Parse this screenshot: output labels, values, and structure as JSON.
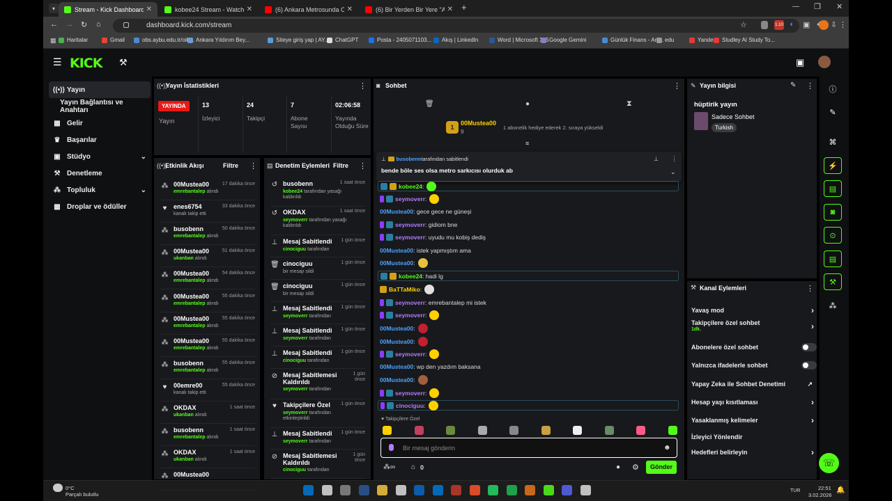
{
  "browser": {
    "tabs": [
      {
        "title": "Stream - Kick Dashboard",
        "color": "#53fc18"
      },
      {
        "title": "kobee24 Stream - Watch Live o",
        "color": "#53fc18"
      },
      {
        "title": "(6) Ankara Metrosunda OSB To",
        "color": "#ff0000"
      },
      {
        "title": "(6) Bir Yerden Bir Yere \"Ankara\"",
        "color": "#ff0000"
      }
    ],
    "url": "dashboard.kick.com/stream",
    "ext_badge": "1.10",
    "bookmarks": [
      "Haritalar",
      "Gmail",
      "obs.aybu.edu.tr/oib...",
      "Ankara Yıldırım Bey...",
      "Siteye giriş yap | AY...",
      "ChatGPT",
      "Posta - 2405071103...",
      "Akış | LinkedIn",
      "Word | Microsoft 365",
      "Google Gemini",
      "Günlük Finans - Anl...",
      "edu",
      "Yandex",
      "Studley AI Study To..."
    ]
  },
  "brand": {
    "logo": "KICK",
    "accent": "#53fc18"
  },
  "nav": [
    {
      "label": "Yayın",
      "icon": "broadcast-icon"
    },
    {
      "label": "Yayın Bağlantısı ve Anahtarı",
      "icon": ""
    },
    {
      "label": "Gelir",
      "icon": "money-icon"
    },
    {
      "label": "Başarılar",
      "icon": "trophy-icon"
    },
    {
      "label": "Stüdyo",
      "icon": "studio-icon"
    },
    {
      "label": "Denetleme",
      "icon": "hammer-icon"
    },
    {
      "label": "Topluluk",
      "icon": "community-icon"
    },
    {
      "label": "Droplar ve ödüller",
      "icon": "drops-icon"
    }
  ],
  "stats": {
    "title": "Yayın İstatistikleri",
    "live_badge": "YAYINDA",
    "live_label": "Yayın",
    "items": [
      {
        "value": "13",
        "label": "İzleyici"
      },
      {
        "value": "24",
        "label": "Takipçi"
      },
      {
        "value": "7",
        "label": "Abone Sayısı"
      },
      {
        "value": "02:06:58",
        "label": "Yayında Olduğu Süre"
      }
    ]
  },
  "activity": {
    "title": "Etkinlik Akışı",
    "filter": "Filtre",
    "events": [
      {
        "name": "00Mustea00",
        "sub": "emrebantalep",
        "sub2": " alındı",
        "time": "17 dakika önce",
        "icon": "gift-icon"
      },
      {
        "name": "enes6754",
        "sub": "",
        "sub2": "kanalı takip etti",
        "time": "33 dakika önce",
        "icon": "heart-icon"
      },
      {
        "name": "busobenn",
        "sub": "emrebantalep",
        "sub2": " alındı",
        "time": "50 dakika önce",
        "icon": "gift-icon"
      },
      {
        "name": "00Mustea00",
        "sub": "ukanban",
        "sub2": " alındı",
        "time": "51 dakika önce",
        "icon": "gift-icon"
      },
      {
        "name": "00Mustea00",
        "sub": "emrebantalep",
        "sub2": " alındı",
        "time": "54 dakika önce",
        "icon": "gift-icon"
      },
      {
        "name": "00Mustea00",
        "sub": "emrebantalep",
        "sub2": " alındı",
        "time": "55 dakika önce",
        "icon": "gift-icon"
      },
      {
        "name": "00Mustea00",
        "sub": "emrebantalep",
        "sub2": " alındı",
        "time": "55 dakika önce",
        "icon": "gift-icon"
      },
      {
        "name": "00Mustea00",
        "sub": "emrebantalep",
        "sub2": " alındı",
        "time": "55 dakika önce",
        "icon": "gift-icon"
      },
      {
        "name": "busobenn",
        "sub": "emrebantalep",
        "sub2": " alındı",
        "time": "55 dakika önce",
        "icon": "gift-icon"
      },
      {
        "name": "00emre00",
        "sub": "",
        "sub2": "kanalı takip etti",
        "time": "55 dakika önce",
        "icon": "heart-icon"
      },
      {
        "name": "OKDAX",
        "sub": "ukanban",
        "sub2": " alındı",
        "time": "1 saat önce",
        "icon": "gift-icon"
      },
      {
        "name": "busobenn",
        "sub": "emrebantalep",
        "sub2": " alındı",
        "time": "1 saat önce",
        "icon": "gift-icon"
      },
      {
        "name": "OKDAX",
        "sub": "ukanban",
        "sub2": " alındı",
        "time": "1 saat önce",
        "icon": "gift-icon"
      },
      {
        "name": "00Mustea00",
        "sub": "",
        "sub2": "",
        "time": "",
        "icon": "gift-icon"
      }
    ]
  },
  "moderation": {
    "title": "Denetim Eylemleri",
    "filter": "Filtre",
    "actions": [
      {
        "name": "busobenn",
        "user": "kobee24",
        "text": " tarafından yasağı kaldırıldı",
        "time": "1 saat önce",
        "icon": "undo-icon"
      },
      {
        "name": "OKDAX",
        "user": "seymoverr",
        "text": " tarafından yasağı kaldırıldı",
        "time": "1 saat önce",
        "icon": "undo-icon"
      },
      {
        "name": "Mesaj Sabitlendi",
        "user": "cinociguu",
        "text": " tarafından",
        "time": "1 gün önce",
        "icon": "pin-icon"
      },
      {
        "name": "cinociguu",
        "user": "",
        "text": "bir mesajı sildi",
        "time": "1 gün önce",
        "icon": "trash-icon"
      },
      {
        "name": "cinociguu",
        "user": "",
        "text": "bir mesajı sildi",
        "time": "1 gün önce",
        "icon": "trash-icon"
      },
      {
        "name": "Mesaj Sabitlendi",
        "user": "seymoverr",
        "text": " tarafından",
        "time": "1 gün önce",
        "icon": "pin-icon"
      },
      {
        "name": "Mesaj Sabitlendi",
        "user": "seymoverr",
        "text": " tarafından",
        "time": "1 gün önce",
        "icon": "pin-icon"
      },
      {
        "name": "Mesaj Sabitlendi",
        "user": "cinociguu",
        "text": " tarafından",
        "time": "1 gün önce",
        "icon": "pin-icon"
      },
      {
        "name": "Mesaj Sabitlemesi Kaldırıldı",
        "user": "seymoverr",
        "text": " tarafından",
        "time": "1 gün önce",
        "icon": "unpin-icon"
      },
      {
        "name": "Takipçilere Özel",
        "user": "seymoverr",
        "text": " tarafından etkinleştirildi",
        "time": "1 gün önce",
        "icon": "heart-icon"
      },
      {
        "name": "Mesaj Sabitlendi",
        "user": "seymoverr",
        "text": " tarafından",
        "time": "1 gün önce",
        "icon": "pin-icon"
      },
      {
        "name": "Mesaj Sabitlemesi Kaldırıldı",
        "user": "cinociguu",
        "text": " tarafından",
        "time": "1 gün önce",
        "icon": "unpin-icon"
      }
    ]
  },
  "chat": {
    "title": "Sohbet",
    "gift_user": "00Mustea00",
    "gift_count": "9",
    "gift_text": "1 abonelik hediye ederek 2. sıraya yükseldi",
    "pinned_by": "busobenn",
    "pinned_suffix": " tarafından sabitlendi",
    "pinned_text": "bende böle ses olsa metro sarkıcısı olurduk ab",
    "messages": [
      {
        "user": "kobee24",
        "color": "#53fc18",
        "text": ":",
        "hl": true,
        "emote": "#53fc18"
      },
      {
        "user": "seymoverr",
        "color": "#b07cff",
        "text": ":",
        "hl": false,
        "emote": "#ffd000"
      },
      {
        "user": "00Mustea00",
        "color": "#4aa3ff",
        "text": ": gece gece ne güneşi",
        "hl": false,
        "emote": ""
      },
      {
        "user": "seymoverr",
        "color": "#b07cff",
        "text": ": gidiom bne",
        "hl": false,
        "emote": ""
      },
      {
        "user": "seymoverr",
        "color": "#b07cff",
        "text": ": uyudu mu kobiş dediş",
        "hl": false,
        "emote": ""
      },
      {
        "user": "00Mustea00",
        "color": "#4aa3ff",
        "text": ": istek yapmıştım ama",
        "hl": false,
        "emote": ""
      },
      {
        "user": "00Mustea00",
        "color": "#4aa3ff",
        "text": ":",
        "hl": false,
        "emote": "#e8c040"
      },
      {
        "user": "kobee24",
        "color": "#53fc18",
        "text": ": hadi lg",
        "hl": true,
        "emote": ""
      },
      {
        "user": "BaTTaMiko",
        "color": "#ffd000",
        "text": ":",
        "hl": false,
        "emote": "#e0e0e0"
      },
      {
        "user": "seymoverr",
        "color": "#b07cff",
        "text": ": emrebantalep mi istek",
        "hl": false,
        "emote": ""
      },
      {
        "user": "seymoverr",
        "color": "#b07cff",
        "text": ":",
        "hl": false,
        "emote": "#ffd000"
      },
      {
        "user": "00Mustea00",
        "color": "#4aa3ff",
        "text": ":",
        "hl": false,
        "emote": "#c02030"
      },
      {
        "user": "00Mustea00",
        "color": "#4aa3ff",
        "text": ":",
        "hl": false,
        "emote": "#c02030"
      },
      {
        "user": "seymoverr",
        "color": "#b07cff",
        "text": ":",
        "hl": false,
        "emote": "#ffd000"
      },
      {
        "user": "00Mustea00",
        "color": "#4aa3ff",
        "text": ": wp den yazdım baksana",
        "hl": false,
        "emote": ""
      },
      {
        "user": "00Mustea00",
        "color": "#4aa3ff",
        "text": ":",
        "hl": false,
        "emote": "#a06040"
      },
      {
        "user": "seymoverr",
        "color": "#b07cff",
        "text": ":",
        "hl": false,
        "emote": "#ffd000"
      },
      {
        "user": "cinociguu",
        "color": "#b07cff",
        "text": ":",
        "hl": true,
        "emote": "#ffd000"
      }
    ],
    "followers_only": "Takipçilere Özel",
    "input_placeholder": "Bir mesaj gönderin",
    "send_label": "Gönder",
    "points": "0"
  },
  "stream_info": {
    "title": "Yayın bilgisi",
    "stream_title": "hüptirik yayın",
    "category": "Sadece Sohbet",
    "language": "Turkish"
  },
  "channel_actions": {
    "title": "Kanal Eylemleri",
    "items": [
      {
        "label": "Yavaş mod",
        "sub": "",
        "type": "arrow"
      },
      {
        "label": "Takipçilere özel sohbet",
        "sub": "1dk.",
        "type": "arrow"
      },
      {
        "label": "Abonelere özel sohbet",
        "sub": "",
        "type": "toggle"
      },
      {
        "label": "Yalnızca ifadelerle sohbet",
        "sub": "",
        "type": "toggle"
      },
      {
        "label": "Yapay Zeka ile Sohbet Denetimi",
        "sub": "",
        "type": "external"
      },
      {
        "label": "Hesap yaşı kısıtlaması",
        "sub": "",
        "type": "arrow"
      },
      {
        "label": "Yasaklanmış kelimeler",
        "sub": "",
        "type": "arrow"
      },
      {
        "label": "İzleyici Yönlendir",
        "sub": "",
        "type": "none"
      },
      {
        "label": "Hedefleri belirleyin",
        "sub": "",
        "type": "arrow"
      }
    ]
  },
  "taskbar": {
    "weather_temp": "0°C",
    "weather_desc": "Parçalı bulutlu",
    "lang": "TUR",
    "time": "22:51",
    "date": "3.02.2026"
  }
}
